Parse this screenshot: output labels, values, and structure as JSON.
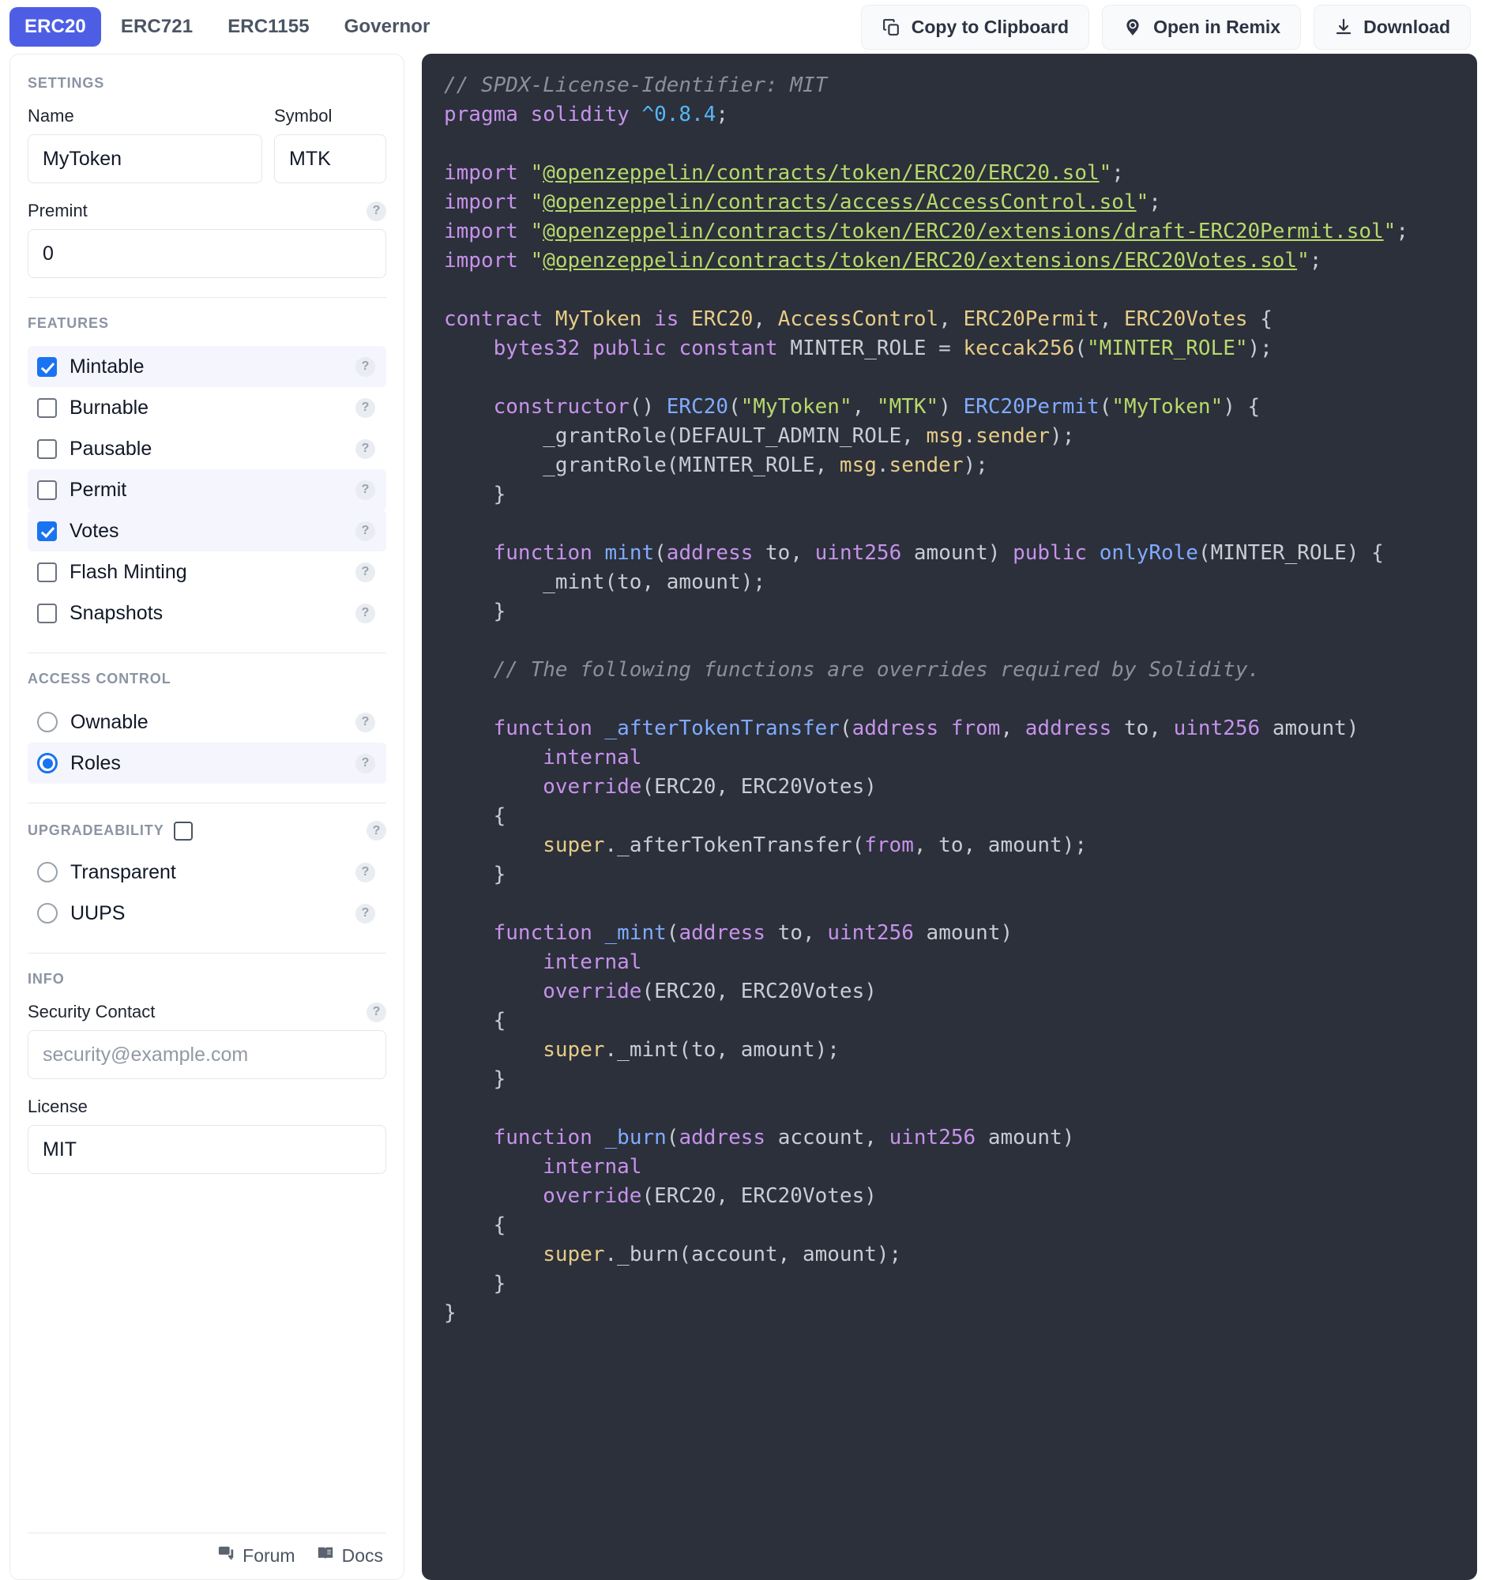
{
  "header": {
    "tabs": [
      {
        "label": "ERC20",
        "active": true
      },
      {
        "label": "ERC721",
        "active": false
      },
      {
        "label": "ERC1155",
        "active": false
      },
      {
        "label": "Governor",
        "active": false
      }
    ],
    "actions": [
      {
        "label": "Copy to Clipboard",
        "icon": "copy-icon"
      },
      {
        "label": "Open in Remix",
        "icon": "remix-icon"
      },
      {
        "label": "Download",
        "icon": "download-icon"
      }
    ]
  },
  "sidebar": {
    "settings": {
      "title": "SETTINGS",
      "name_label": "Name",
      "name_value": "MyToken",
      "symbol_label": "Symbol",
      "symbol_value": "MTK",
      "premint_label": "Premint",
      "premint_value": "0"
    },
    "features": {
      "title": "FEATURES",
      "items": [
        {
          "label": "Mintable",
          "checked": true
        },
        {
          "label": "Burnable",
          "checked": false
        },
        {
          "label": "Pausable",
          "checked": false
        },
        {
          "label": "Permit",
          "checked": false
        },
        {
          "label": "Votes",
          "checked": true
        },
        {
          "label": "Flash Minting",
          "checked": false
        },
        {
          "label": "Snapshots",
          "checked": false
        }
      ]
    },
    "access_control": {
      "title": "ACCESS CONTROL",
      "items": [
        {
          "label": "Ownable",
          "selected": false
        },
        {
          "label": "Roles",
          "selected": true
        }
      ]
    },
    "upgradeability": {
      "title": "UPGRADEABILITY",
      "enabled": false,
      "items": [
        {
          "label": "Transparent",
          "selected": false
        },
        {
          "label": "UUPS",
          "selected": false
        }
      ]
    },
    "info": {
      "title": "INFO",
      "security_contact_label": "Security Contact",
      "security_contact_placeholder": "security@example.com",
      "security_contact_value": "",
      "license_label": "License",
      "license_value": "MIT"
    },
    "footer": [
      {
        "label": "Forum",
        "icon": "forum-icon"
      },
      {
        "label": "Docs",
        "icon": "book-icon"
      }
    ]
  },
  "code": {
    "language": "solidity",
    "lines": [
      "// SPDX-License-Identifier: MIT",
      "pragma solidity ^0.8.4;",
      "",
      "import \"@openzeppelin/contracts/token/ERC20/ERC20.sol\";",
      "import \"@openzeppelin/contracts/access/AccessControl.sol\";",
      "import \"@openzeppelin/contracts/token/ERC20/extensions/draft-ERC20Permit.sol\";",
      "import \"@openzeppelin/contracts/token/ERC20/extensions/ERC20Votes.sol\";",
      "",
      "contract MyToken is ERC20, AccessControl, ERC20Permit, ERC20Votes {",
      "    bytes32 public constant MINTER_ROLE = keccak256(\"MINTER_ROLE\");",
      "",
      "    constructor() ERC20(\"MyToken\", \"MTK\") ERC20Permit(\"MyToken\") {",
      "        _grantRole(DEFAULT_ADMIN_ROLE, msg.sender);",
      "        _grantRole(MINTER_ROLE, msg.sender);",
      "    }",
      "",
      "    function mint(address to, uint256 amount) public onlyRole(MINTER_ROLE) {",
      "        _mint(to, amount);",
      "    }",
      "",
      "    // The following functions are overrides required by Solidity.",
      "",
      "    function _afterTokenTransfer(address from, address to, uint256 amount)",
      "        internal",
      "        override(ERC20, ERC20Votes)",
      "    {",
      "        super._afterTokenTransfer(from, to, amount);",
      "    }",
      "",
      "    function _mint(address to, uint256 amount)",
      "        internal",
      "        override(ERC20, ERC20Votes)",
      "    {",
      "        super._mint(to, amount);",
      "    }",
      "",
      "    function _burn(address account, uint256 amount)",
      "        internal",
      "        override(ERC20, ERC20Votes)",
      "    {",
      "        super._burn(account, amount);",
      "    }",
      "}"
    ]
  },
  "colors": {
    "accent": "#4e5ee4",
    "checkbox_blue": "#1a73f0",
    "code_bg": "#2b303b",
    "selected_row": "#f5f5fd"
  }
}
